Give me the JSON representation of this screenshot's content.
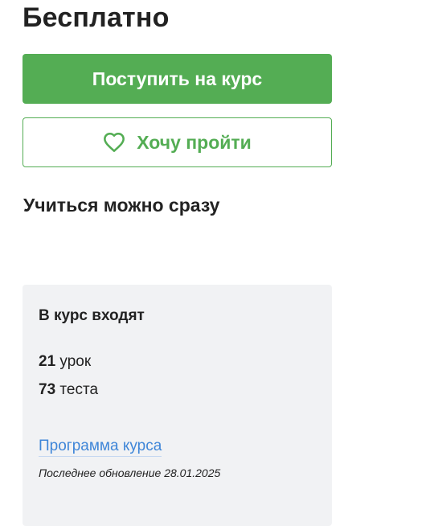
{
  "price": "Бесплатно",
  "actions": {
    "enroll_label": "Поступить на курс",
    "wishlist_label": "Хочу пройти",
    "wishlist_icon": "heart-outline-icon"
  },
  "start_note": "Учиться можно сразу",
  "colors": {
    "accent_green": "#54ad54",
    "link_blue": "#3f86d8",
    "card_background": "#f1f2f4"
  },
  "course_info": {
    "title": "В курс входят",
    "lessons": {
      "count": "21",
      "label": "урок"
    },
    "tests": {
      "count": "73",
      "label": "теста"
    },
    "program_link": "Программа курса",
    "last_update": "Последнее обновление 28.01.2025"
  }
}
